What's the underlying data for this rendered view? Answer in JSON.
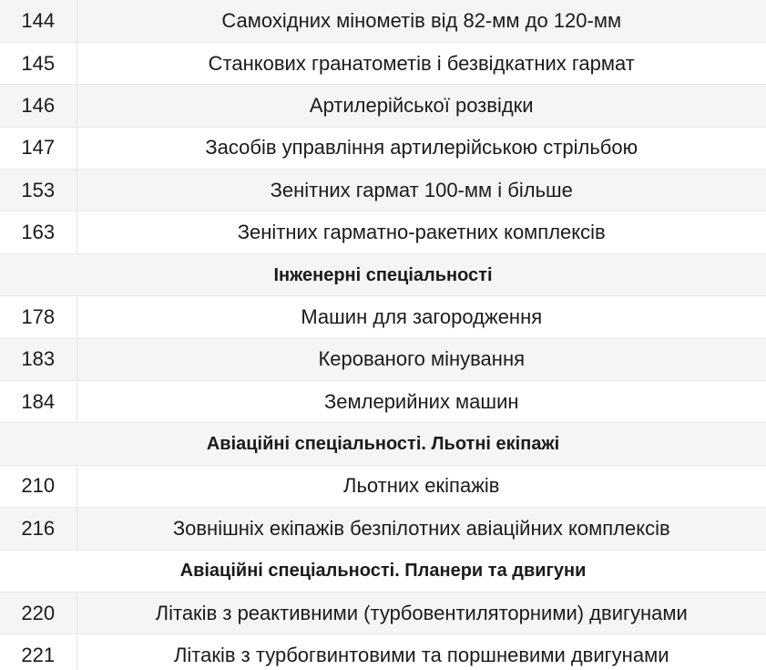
{
  "rows": [
    {
      "type": "item",
      "code": "144",
      "name": "Самохідних мінометів від 82-мм до 120-мм"
    },
    {
      "type": "item",
      "code": "145",
      "name": "Станкових гранатометів і безвідкатних гармат"
    },
    {
      "type": "item",
      "code": "146",
      "name": "Артилерійської розвідки"
    },
    {
      "type": "item",
      "code": "147",
      "name": "Засобів управління артилерійською стрільбою"
    },
    {
      "type": "item",
      "code": "153",
      "name": "Зенітних гармат 100-мм і більше"
    },
    {
      "type": "item",
      "code": "163",
      "name": "Зенітних гарматно-ракетних комплексів"
    },
    {
      "type": "section",
      "title": "Інженерні спеціальності"
    },
    {
      "type": "item",
      "code": "178",
      "name": "Машин для загородження"
    },
    {
      "type": "item",
      "code": "183",
      "name": "Керованого мінування"
    },
    {
      "type": "item",
      "code": "184",
      "name": "Землерийних машин"
    },
    {
      "type": "section",
      "title": "Авіаційні спеціальності. Льотні екіпажі"
    },
    {
      "type": "item",
      "code": "210",
      "name": "Льотних екіпажів"
    },
    {
      "type": "item",
      "code": "216",
      "name": "Зовнішніх екіпажів безпілотних авіаційних комплексів"
    },
    {
      "type": "section",
      "title": "Авіаційні спеціальності. Планери та двигуни"
    },
    {
      "type": "item",
      "code": "220",
      "name": "Літаків з реактивними (турбовентиляторними) двигунами"
    },
    {
      "type": "item",
      "code": "221",
      "name": "Літаків з турбогвинтовими та поршневими двигунами"
    }
  ]
}
